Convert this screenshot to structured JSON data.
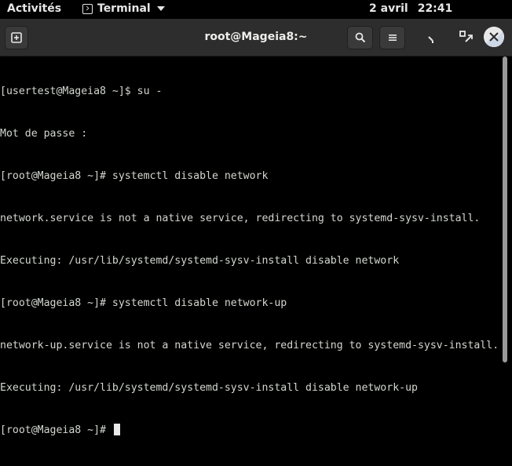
{
  "topbar": {
    "activities": "Activités",
    "app_name": "Terminal",
    "date": "2 avril",
    "time": "22:41"
  },
  "window": {
    "title": "root@Mageia8:~"
  },
  "terminal": {
    "lines": [
      "[usertest@Mageia8 ~]$ su -",
      "Mot de passe :",
      "[root@Mageia8 ~]# systemctl disable network",
      "network.service is not a native service, redirecting to systemd-sysv-install.",
      "Executing: /usr/lib/systemd/systemd-sysv-install disable network",
      "[root@Mageia8 ~]# systemctl disable network-up",
      "network-up.service is not a native service, redirecting to systemd-sysv-install.",
      "Executing: /usr/lib/systemd/systemd-sysv-install disable network-up",
      "[root@Mageia8 ~]# "
    ]
  },
  "colors": {
    "terminal_bg": "#000000",
    "terminal_fg": "#d3d7cf",
    "headerbar": "#2d2d2d"
  },
  "icons": {
    "new_tab": "new-tab-icon",
    "search": "search-icon",
    "menu": "hamburger-menu-icon",
    "minimize": "minimize-icon",
    "maximize": "maximize-icon",
    "close": "close-icon"
  }
}
